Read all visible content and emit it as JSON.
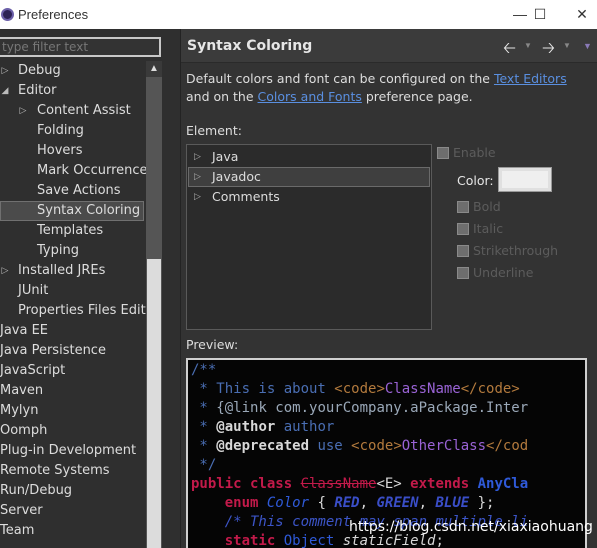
{
  "window": {
    "title": "Preferences",
    "minimize": "—",
    "maximize": "☐",
    "close": "✕"
  },
  "filter": {
    "placeholder": "type filter text"
  },
  "tree": [
    {
      "label": "Debug",
      "expander": "▷"
    },
    {
      "label": "Editor",
      "expander": "◢"
    },
    {
      "label": "Content Assist",
      "expander": "▷"
    },
    {
      "label": "Folding",
      "expander": ""
    },
    {
      "label": "Hovers",
      "expander": ""
    },
    {
      "label": "Mark Occurrences",
      "expander": ""
    },
    {
      "label": "Save Actions",
      "expander": ""
    },
    {
      "label": "Syntax Coloring",
      "expander": "",
      "selected": true
    },
    {
      "label": "Templates",
      "expander": ""
    },
    {
      "label": "Typing",
      "expander": ""
    },
    {
      "label": "Installed JREs",
      "expander": "▷"
    },
    {
      "label": "JUnit",
      "expander": ""
    },
    {
      "label": "Properties Files Editor",
      "expander": ""
    },
    {
      "label": "Java EE",
      "expander": ""
    },
    {
      "label": "Java Persistence",
      "expander": ""
    },
    {
      "label": "JavaScript",
      "expander": ""
    },
    {
      "label": "Maven",
      "expander": ""
    },
    {
      "label": "Mylyn",
      "expander": ""
    },
    {
      "label": "Oomph",
      "expander": ""
    },
    {
      "label": "Plug-in Development",
      "expander": ""
    },
    {
      "label": "Remote Systems",
      "expander": ""
    },
    {
      "label": "Run/Debug",
      "expander": ""
    },
    {
      "label": "Server",
      "expander": ""
    },
    {
      "label": "Team",
      "expander": ""
    }
  ],
  "page": {
    "title": "Syntax Coloring",
    "back_icon": "arrow-back-icon",
    "forward_icon": "arrow-forward-icon",
    "description_before": "Default colors and font can be configured on the ",
    "link_text_editors": "Text Editors",
    "description_middle": " and on the ",
    "link_colors_fonts": "Colors and Fonts",
    "description_after": " preference page.",
    "element_label": "Element:",
    "elements": [
      {
        "label": "Java",
        "expander": "▷",
        "selected": false
      },
      {
        "label": "Javadoc",
        "expander": "▷",
        "selected": true
      },
      {
        "label": "Comments",
        "expander": "▷",
        "selected": false
      }
    ],
    "enable_label": "Enable",
    "color_label": "Color:",
    "bold_label": "Bold",
    "italic_label": "Italic",
    "strikethrough_label": "Strikethrough",
    "underline_label": "Underline",
    "preview_label": "Preview:"
  },
  "preview": {
    "l1": "/**",
    "l2_a": " * This is about ",
    "l2_b": "<code>",
    "l2_c": "ClassName",
    "l2_d": "</code>",
    "l2_e": " ",
    "l3_a": " * ",
    "l3_b": "{@link com.yourCompany.aPackage.Inter",
    "l4_a": " * ",
    "l4_b": "@author",
    "l4_c": " author",
    "l5_a": " * ",
    "l5_b": "@deprecated",
    "l5_c": " use ",
    "l5_d": "<code>",
    "l5_e": "OtherClass",
    "l5_f": "</cod",
    "l6": " */",
    "l7_a": "public class ",
    "l7_b": "ClassName",
    "l7_c": "<E> ",
    "l7_d": "extends ",
    "l7_e": "AnyCla",
    "l8_a": "    enum ",
    "l8_b": "Color",
    "l8_c": " { ",
    "l8_d": "RED",
    "l8_e": ", ",
    "l8_f": "GREEN",
    "l8_g": ", ",
    "l8_h": "BLUE",
    "l8_i": " };",
    "l9": "    /* This comment may span multiple li",
    "l10_a": "    static ",
    "l10_b": "Object ",
    "l10_c": "staticField",
    "l10_d": ";"
  },
  "watermark": "https://blog.csdn.net/xiaxiaohuang"
}
